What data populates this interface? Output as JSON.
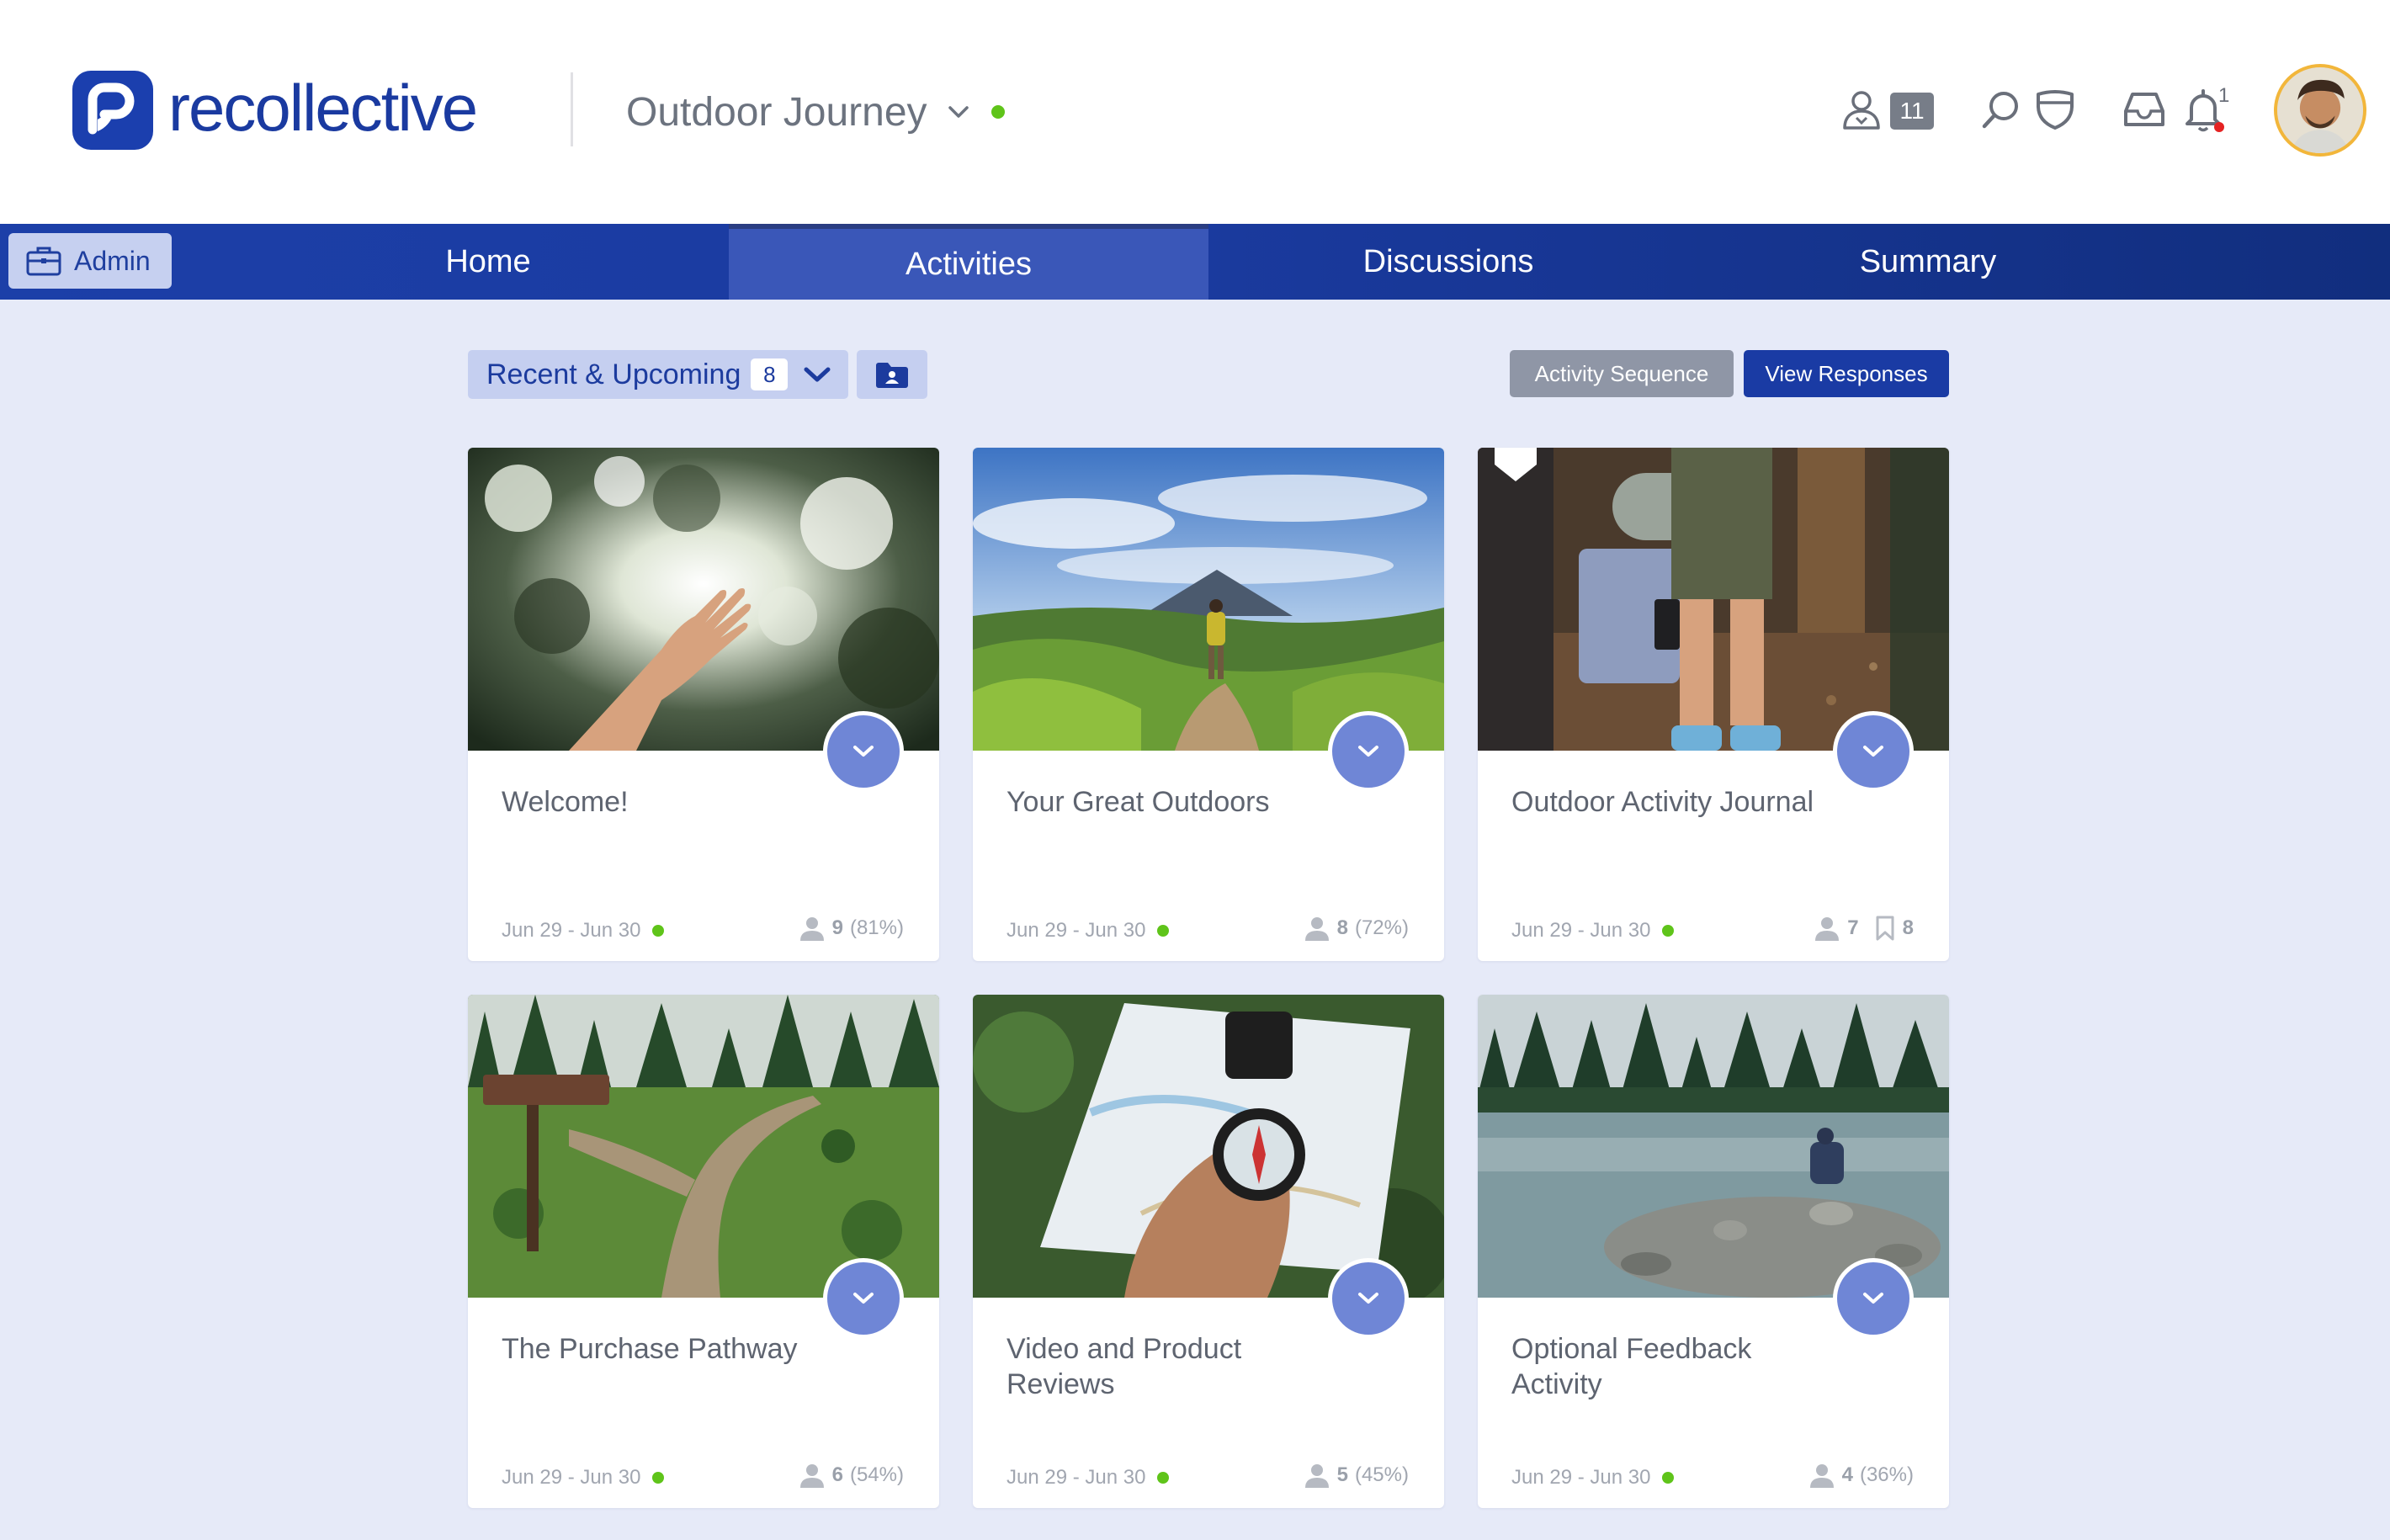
{
  "header": {
    "logo_text": "recollective",
    "project_name": "Outdoor Journey",
    "participants_count": "11",
    "notifications_count": "1"
  },
  "nav": {
    "admin_label": "Admin",
    "tabs": [
      {
        "label": "Home"
      },
      {
        "label": "Activities"
      },
      {
        "label": "Discussions"
      },
      {
        "label": "Summary"
      }
    ],
    "active_tab": "Activities"
  },
  "toolbar": {
    "filter_label": "Recent & Upcoming",
    "filter_count": "8",
    "sequence_label": "Activity Sequence",
    "responses_label": "View Responses"
  },
  "cards": [
    {
      "title": "Welcome!",
      "dates": "Jun 29 - Jun 30",
      "participants": "9",
      "percent": "(81%)"
    },
    {
      "title": "Your Great Outdoors",
      "dates": "Jun 29 - Jun 30",
      "participants": "8",
      "percent": "(72%)"
    },
    {
      "title": "Outdoor Activity Journal",
      "dates": "Jun 29 - Jun 30",
      "participants": "7",
      "bookmarks": "8"
    },
    {
      "title": "The Purchase Pathway",
      "dates": "Jun 29 - Jun 30",
      "participants": "6",
      "percent": "(54%)"
    },
    {
      "title": "Video and Product Reviews",
      "dates": "Jun 29 - Jun 30",
      "participants": "5",
      "percent": "(45%)"
    },
    {
      "title": "Optional Feedback Activity",
      "dates": "Jun 29 - Jun 30",
      "participants": "4",
      "percent": "(36%)"
    }
  ],
  "colors": {
    "brand": "#1a3aa0",
    "nav": "#1c3fa8",
    "accent_button": "#1a3ba4",
    "toggle": "#6f86d6",
    "live": "#5fc41a",
    "page_bg": "#e6eaf8"
  }
}
